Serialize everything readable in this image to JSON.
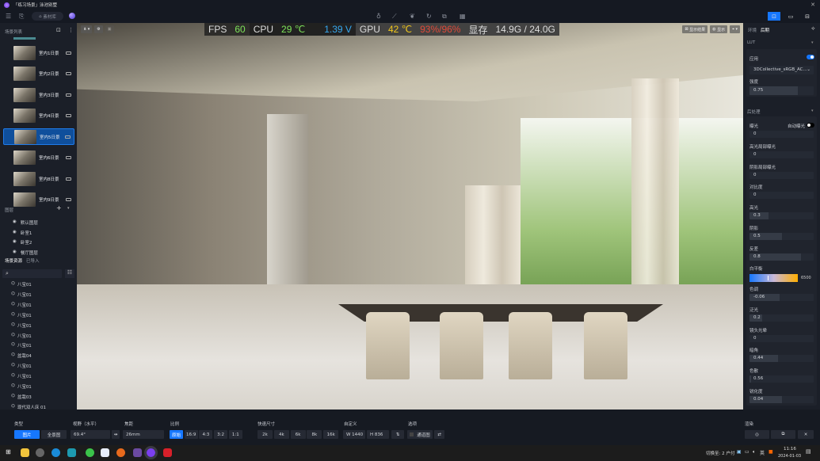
{
  "app": {
    "title": "「练习场景」泳池别墅",
    "material_library": "素材库"
  },
  "toolbar": {
    "icons": [
      "menu-icon",
      "import-icon",
      "bulb-icon",
      "path-icon",
      "leaf-icon",
      "refresh-icon",
      "camera-add-icon",
      "grid-icon"
    ],
    "right_icons": [
      "render-image-icon",
      "video-icon",
      "export-icon"
    ],
    "accent": "#1677ff"
  },
  "left": {
    "scene_list_title": "场景列表",
    "scenes": [
      {
        "label": "室内1日景"
      },
      {
        "label": "室内2日景"
      },
      {
        "label": "室内3日景"
      },
      {
        "label": "室内4日景"
      },
      {
        "label": "室内5日景",
        "selected": true
      },
      {
        "label": "室内6日景"
      },
      {
        "label": "室内8日景"
      },
      {
        "label": "室内9日景"
      }
    ],
    "layers_title": "图层",
    "layers": [
      "默认图层",
      "卧室1",
      "卧室2",
      "餐厅图层"
    ],
    "assets_tab": "场景资源",
    "imported_tab": "已导入",
    "assets": [
      "八宝01",
      "八宝01",
      "八宝01",
      "八宝01",
      "八宝01",
      "八宝01",
      "八宝01",
      "盆栽04",
      "八宝01",
      "八宝01",
      "八宝01",
      "盆栽03",
      "现代双人床 01"
    ]
  },
  "hud": {
    "fps_label": "FPS",
    "fps": "60",
    "cpu_label": "CPU",
    "cpu_temp": "29 ℃",
    "cpu_volt": "1.39 V",
    "gpu_label": "GPU",
    "gpu_temp": "42 ℃",
    "gpu_load": "93%/96%",
    "vram_label": "显存",
    "vram": "14.9G / 24.0G"
  },
  "viewport": {
    "btn_show_results": "显示结果",
    "btn_display": "显示"
  },
  "right": {
    "tab_env": "环境",
    "tab_post": "后期",
    "lut_title": "LUT",
    "apply_label": "应用",
    "apply_on": true,
    "lut_value": "3DCollective_sRGB_AC...",
    "intensity_label": "强度",
    "intensity": "0.75",
    "post_title": "后处理",
    "auto_exposure_label": "自动曝光",
    "params": [
      {
        "label": "曝光",
        "value": "0",
        "fill": 0
      },
      {
        "label": "高光局部曝光",
        "value": "0",
        "fill": 0
      },
      {
        "label": "阴影局部曝光",
        "value": "0",
        "fill": 0
      },
      {
        "label": "对比度",
        "value": "0",
        "fill": 0
      },
      {
        "label": "高光",
        "value": "0.3",
        "fill": 0.3
      },
      {
        "label": "阴影",
        "value": "0.5",
        "fill": 0.5
      },
      {
        "label": "反差",
        "value": "0.8",
        "fill": 0.8
      }
    ],
    "wb_label": "白平衡",
    "wb_value": "6500",
    "params2": [
      {
        "label": "色调",
        "value": "-0.06",
        "fill": 0.47
      },
      {
        "label": "泛光",
        "value": "0.2",
        "fill": 0.2
      },
      {
        "label": "镜头光晕",
        "value": "0",
        "fill": 0
      },
      {
        "label": "暗角",
        "value": "0.44",
        "fill": 0.44
      },
      {
        "label": "色散",
        "value": "0.56",
        "fill": 0.02
      },
      {
        "label": "锐化度",
        "value": "0.04",
        "fill": 0.5
      }
    ]
  },
  "bottom": {
    "type_label": "类型",
    "type_image": "图片",
    "type_pano": "全景图",
    "fov_label": "视野（水平）",
    "fov": "69.4°",
    "focal_label": "焦距",
    "focal": "26mm",
    "ratio_label": "比例",
    "ratios": [
      "原始",
      "16:9",
      "4:3",
      "3:2",
      "1:1"
    ],
    "size_label": "快速尺寸",
    "sizes": [
      "2k",
      "4k",
      "6k",
      "8k",
      "16k"
    ],
    "custom_label": "自定义",
    "w": "W 1440",
    "h": "H 836",
    "options_label": "选项",
    "channel": "通道图",
    "render_label": "渲染"
  },
  "taskbar": {
    "switch_text": "切换至: 2 户付 ^",
    "lang": "英",
    "time": "11:16",
    "date": "2024-01-03"
  }
}
